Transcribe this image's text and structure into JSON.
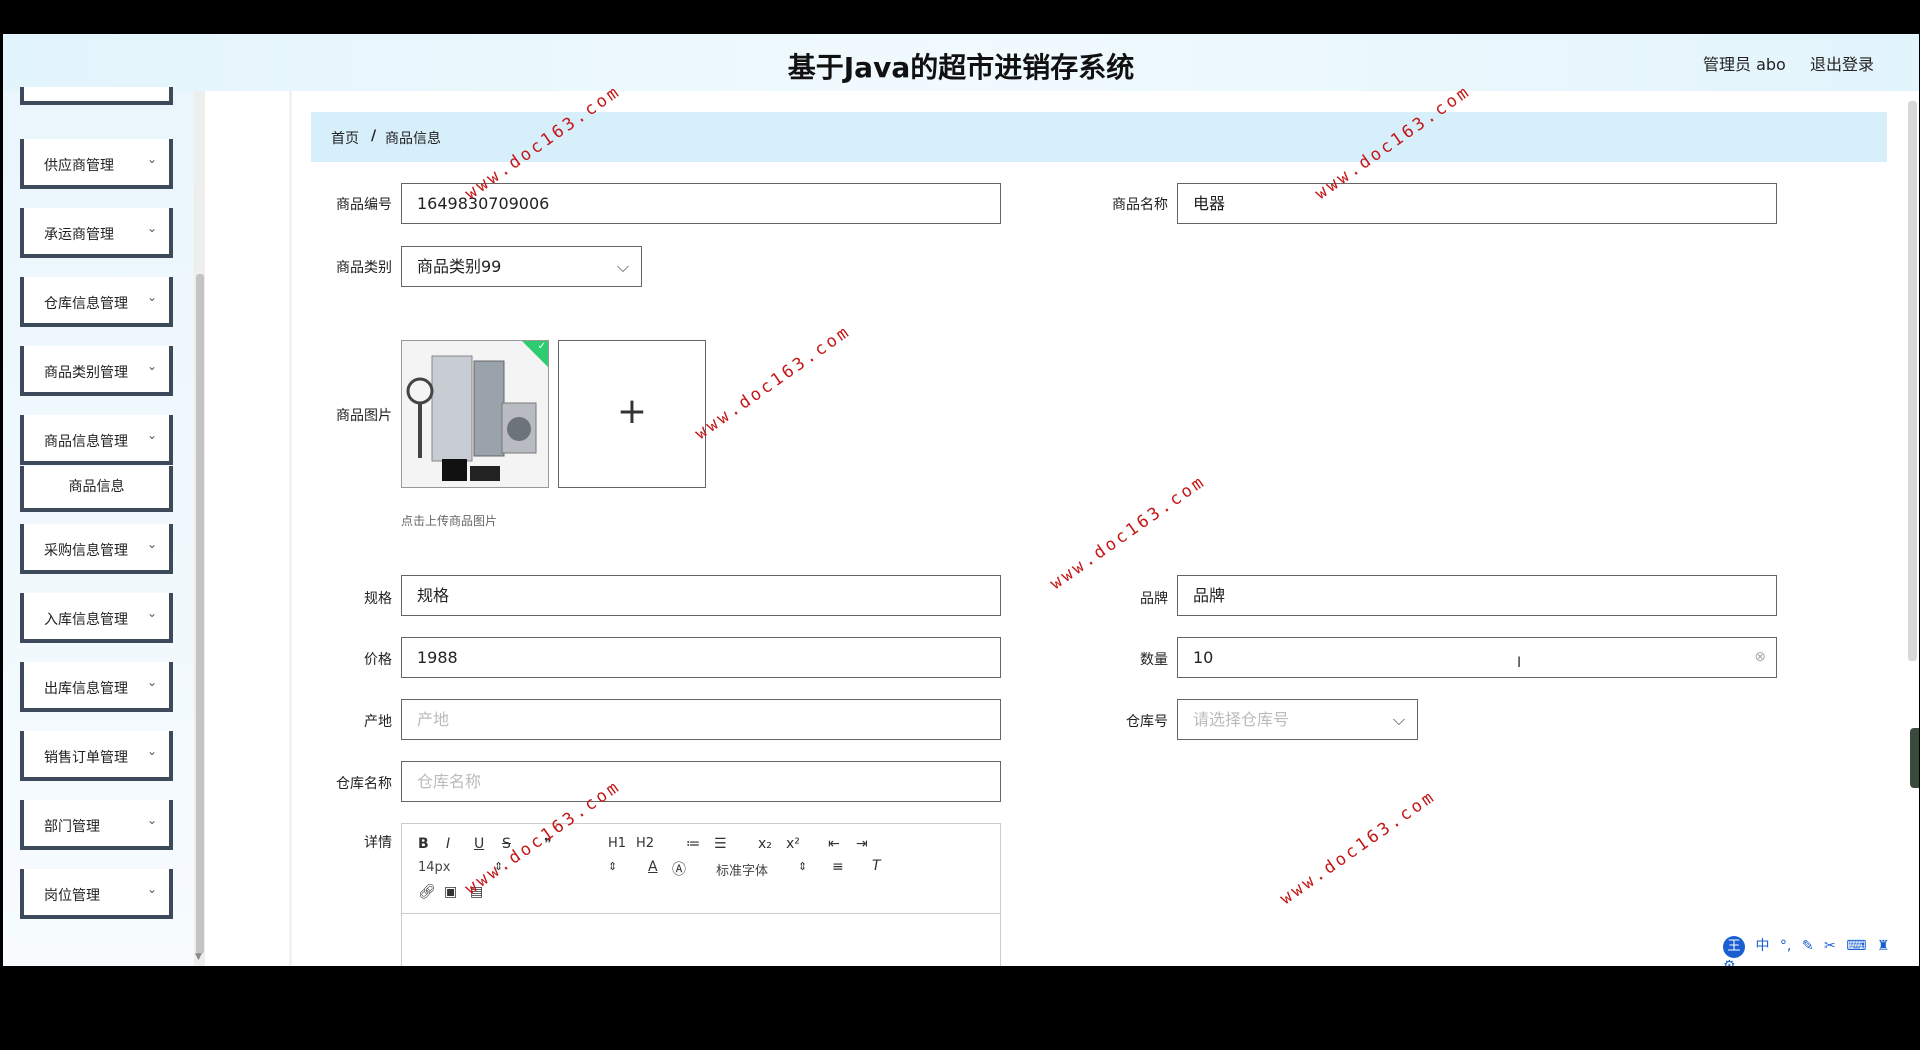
{
  "header": {
    "title": "基于Java的超市进销存系统",
    "user": "管理员 abo",
    "logout": "退出登录"
  },
  "sidebar": {
    "items": [
      {
        "label": "供应商管理"
      },
      {
        "label": "承运商管理"
      },
      {
        "label": "仓库信息管理"
      },
      {
        "label": "商品类别管理"
      },
      {
        "label": "商品信息管理"
      },
      {
        "label": "商品信息"
      },
      {
        "label": "采购信息管理"
      },
      {
        "label": "入库信息管理"
      },
      {
        "label": "出库信息管理"
      },
      {
        "label": "销售订单管理"
      },
      {
        "label": "部门管理"
      },
      {
        "label": "岗位管理"
      }
    ],
    "chevron": "⌄"
  },
  "breadcrumb": {
    "home": "首页",
    "separator": "/",
    "current": "商品信息"
  },
  "form": {
    "code": {
      "label": "商品编号",
      "value": "1649830709006"
    },
    "name": {
      "label": "商品名称",
      "value": "电器"
    },
    "category": {
      "label": "商品类别",
      "value": "商品类别99"
    },
    "image": {
      "label": "商品图片",
      "tip": "点击上传商品图片",
      "add": "+"
    },
    "spec": {
      "label": "规格",
      "value": "规格"
    },
    "brand": {
      "label": "品牌",
      "value": "品牌"
    },
    "price": {
      "label": "价格",
      "value": "1988"
    },
    "quantity": {
      "label": "数量",
      "value": "10"
    },
    "origin": {
      "label": "产地",
      "placeholder": "产地"
    },
    "warehouse_no": {
      "label": "仓库号",
      "placeholder": "请选择仓库号"
    },
    "warehouse_name": {
      "label": "仓库名称",
      "placeholder": "仓库名称"
    },
    "detail": {
      "label": "详情"
    }
  },
  "editor": {
    "font_size": "14px",
    "font_family": "标准字体",
    "tools": [
      "B",
      "I",
      "U",
      "S",
      "❞",
      "H1",
      "H2",
      "≔",
      "☰",
      "x₂",
      "x²",
      "⇤",
      "⇥"
    ]
  },
  "watermark": "www.doc163.com",
  "ime": {
    "logo": "王",
    "lang": "中"
  },
  "colors": {
    "header_bg": "#e2f4fc",
    "breadcrumb_bg": "#d6effb",
    "sidebar_border": "#3d4a5c",
    "watermark": "#c41616"
  }
}
